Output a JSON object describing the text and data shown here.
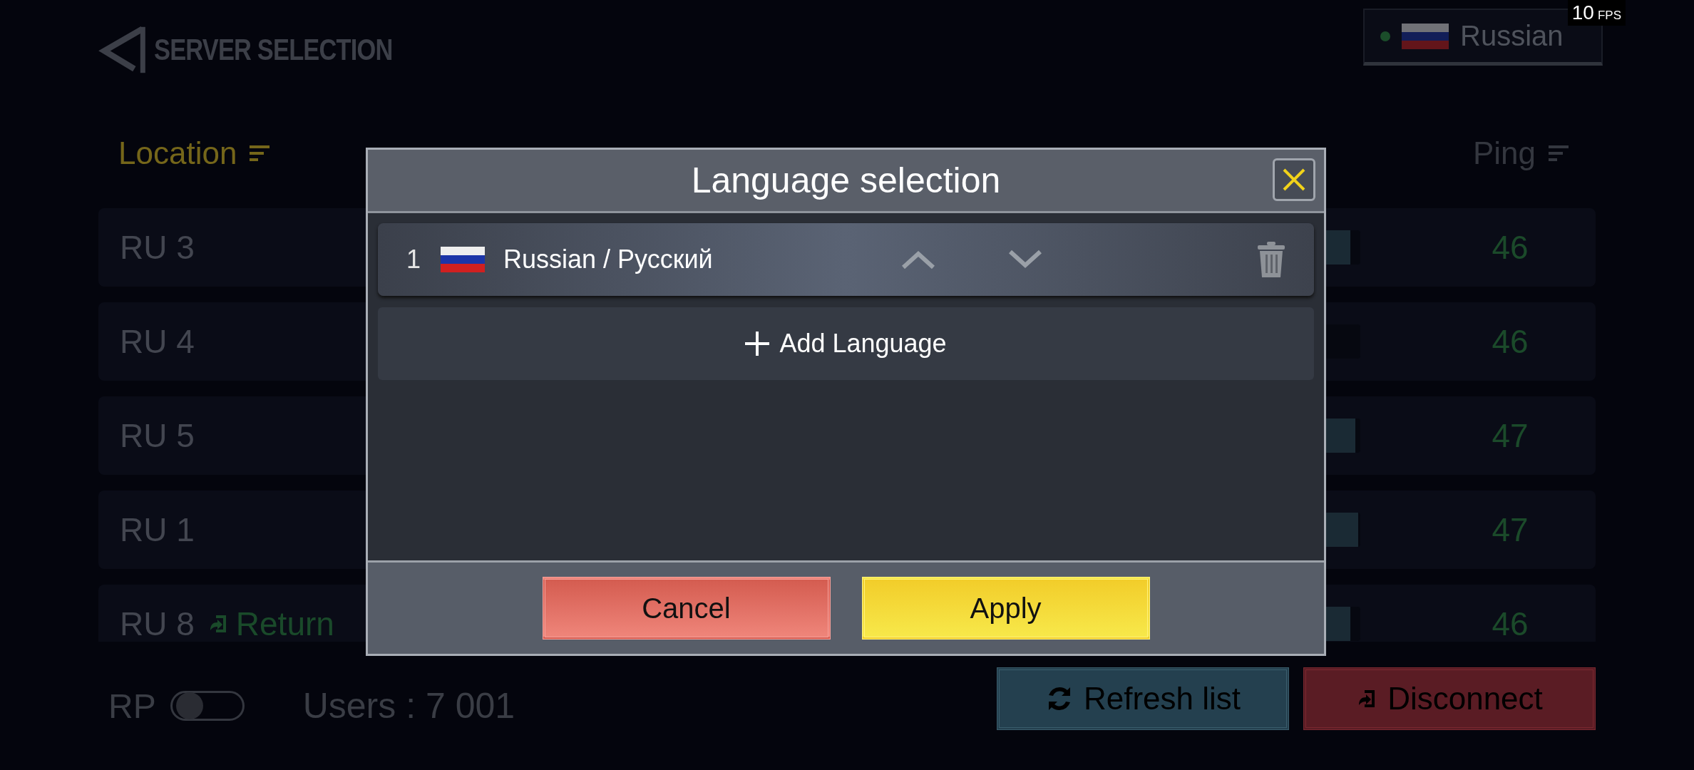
{
  "header": {
    "title": "SERVER SELECTION",
    "language": {
      "label": "Russian",
      "online": true
    }
  },
  "fps": {
    "value": "10",
    "unit": "FPS"
  },
  "columns": [
    {
      "label": "Location",
      "sortable": true,
      "active": true
    },
    {
      "label": "Ping",
      "sortable": true,
      "active": false
    }
  ],
  "servers": [
    {
      "name": "RU 3",
      "level": 0.92,
      "ping": "46"
    },
    {
      "name": "RU 4",
      "level": 0.0,
      "ping": "46"
    },
    {
      "name": "RU 5",
      "level": 0.96,
      "ping": "47"
    },
    {
      "name": "RU 1",
      "level": 0.98,
      "ping": "47"
    },
    {
      "name": "RU 8",
      "return_label": "Return",
      "level": 0.92,
      "ping": "46"
    }
  ],
  "footer": {
    "rp_label": "RP",
    "rp_on": false,
    "users": "Users : 7 001",
    "buttons": [
      {
        "label": "Refresh list",
        "kind": "refresh"
      },
      {
        "label": "Disconnect",
        "kind": "disconnect"
      }
    ]
  },
  "dialog": {
    "title": "Language selection",
    "languages": [
      {
        "index": "1",
        "name": "Russian / Русский"
      }
    ],
    "add_label": "Add Language",
    "buttons": [
      {
        "label": "Cancel",
        "kind": "cancel"
      },
      {
        "label": "Apply",
        "kind": "apply"
      }
    ]
  }
}
